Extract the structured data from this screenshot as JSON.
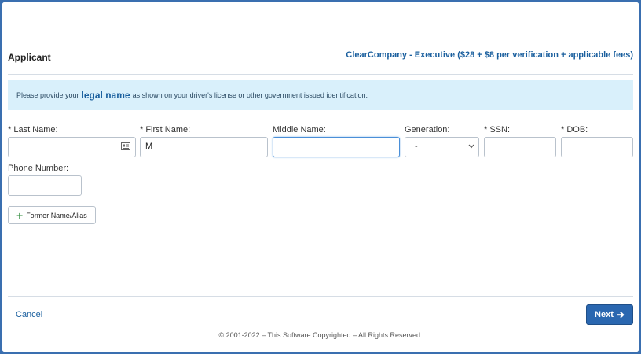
{
  "header": {
    "title": "Applicant",
    "plan": "ClearCompany - Executive ($28 + $8 per verification + applicable fees)"
  },
  "notice": {
    "prefix": "Please provide your",
    "emphasis": "legal name",
    "suffix": "as shown on your driver's license or other government issued identification."
  },
  "form": {
    "last_name": {
      "label": "* Last Name:",
      "value": ""
    },
    "first_name": {
      "label": "* First Name:",
      "value": "M"
    },
    "middle_name": {
      "label": "Middle Name:",
      "value": ""
    },
    "generation": {
      "label": "Generation:",
      "value": "-"
    },
    "ssn": {
      "label": "* SSN:",
      "value": ""
    },
    "dob": {
      "label": "* DOB:",
      "value": ""
    },
    "phone": {
      "label": "Phone Number:",
      "value": ""
    }
  },
  "alias_button": {
    "label": "Former Name/Alias",
    "icon": "plus-icon"
  },
  "footer": {
    "cancel": "Cancel",
    "next": "Next",
    "copyright": "© 2001-2022 – This Software Copyrighted – All Rights Reserved."
  },
  "colors": {
    "brand": "#1a5f9e",
    "primary_button": "#2a67b0",
    "notice_bg": "#d9f0fb",
    "background": "#3a6fb0"
  }
}
